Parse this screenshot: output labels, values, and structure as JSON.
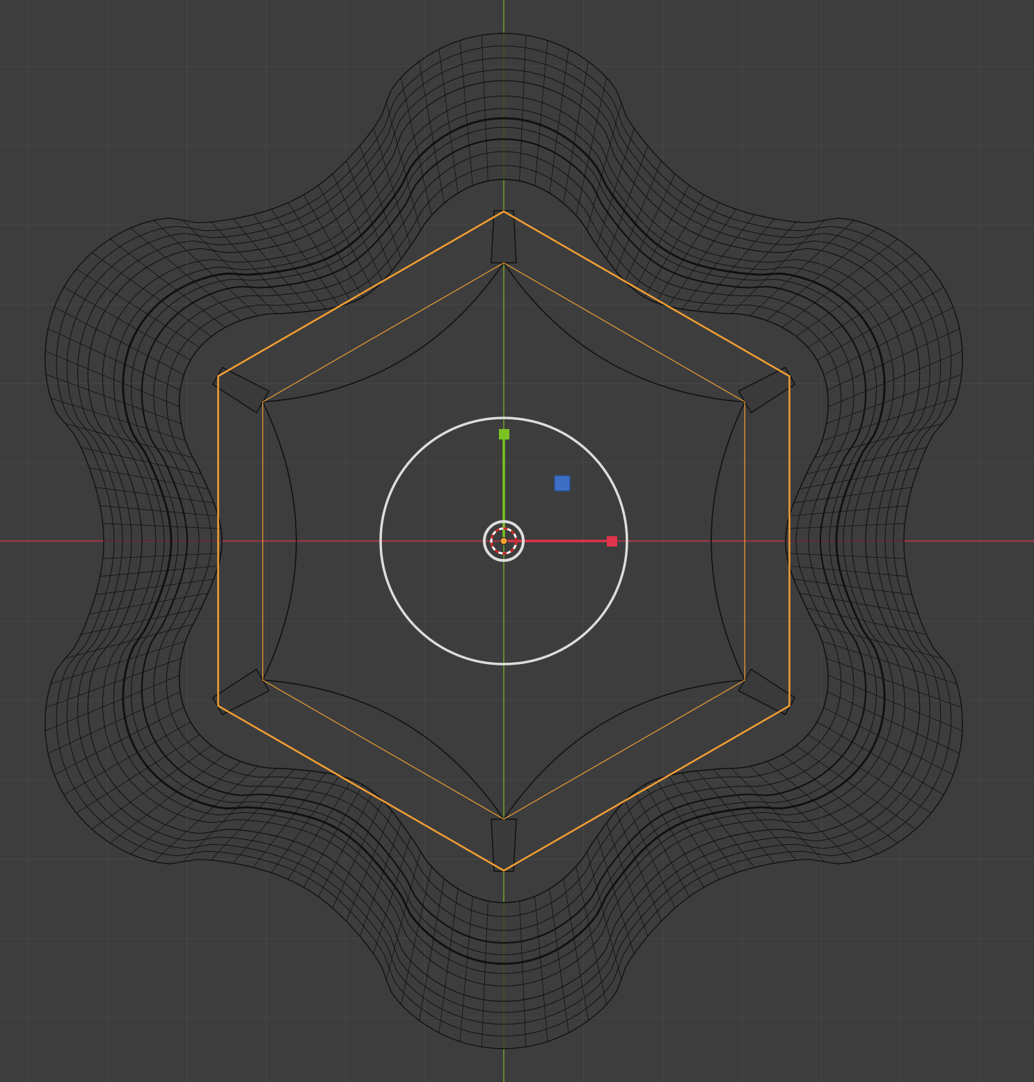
{
  "viewport": {
    "view": "top-orthographic",
    "shading": "wireframe",
    "background_color": "#3d3d3d",
    "grid_color": "#4a4a4a",
    "grid_visible": true
  },
  "axes": {
    "x_axis_color": "#c8334a",
    "y_axis_color": "#6fa32b"
  },
  "mesh": {
    "shape": "six-pointed star",
    "wire_color": "#111111",
    "selected_outline_color": "#f5a033"
  },
  "gizmo": {
    "type": "transform",
    "ring_color": "#dddddd",
    "x_handle_color": "#e0344b",
    "y_handle_color": "#7ac321",
    "z_handle_color": "#3d6fc4",
    "origin_color": "#f5a033",
    "cursor_color": "#cc2222"
  }
}
